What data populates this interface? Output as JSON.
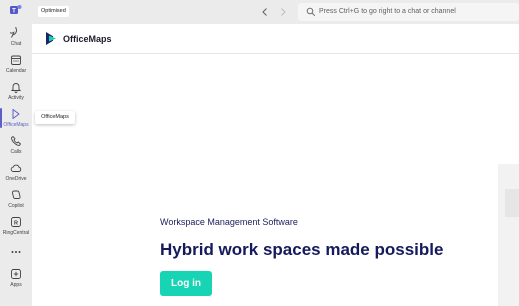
{
  "topbar": {
    "badge": "Optimised",
    "search_placeholder": "Press Ctrl+G to go right to a chat or channel"
  },
  "rail": {
    "items": [
      {
        "label": "Chat",
        "icon": "chat-icon"
      },
      {
        "label": "Calendar",
        "icon": "calendar-icon"
      },
      {
        "label": "Activity",
        "icon": "bell-icon"
      },
      {
        "label": "OfficeMaps",
        "icon": "officemaps-icon",
        "active": true
      },
      {
        "label": "Calls",
        "icon": "phone-icon"
      },
      {
        "label": "OneDrive",
        "icon": "cloud-icon"
      },
      {
        "label": "Copilot",
        "icon": "copilot-icon"
      },
      {
        "label": "RingCentral",
        "icon": "ringcentral-icon"
      },
      {
        "label": "",
        "icon": "more-icon"
      },
      {
        "label": "Apps",
        "icon": "apps-icon"
      }
    ]
  },
  "tooltip": "OfficeMaps",
  "app": {
    "title": "OfficeMaps",
    "hero_subtitle": "Workspace Management Software",
    "hero_title": "Hybrid work spaces made possible",
    "login_label": "Log in"
  },
  "colors": {
    "accent": "#5b5fc7",
    "brand_teal": "#17d4b4",
    "navy": "#141a5c"
  }
}
